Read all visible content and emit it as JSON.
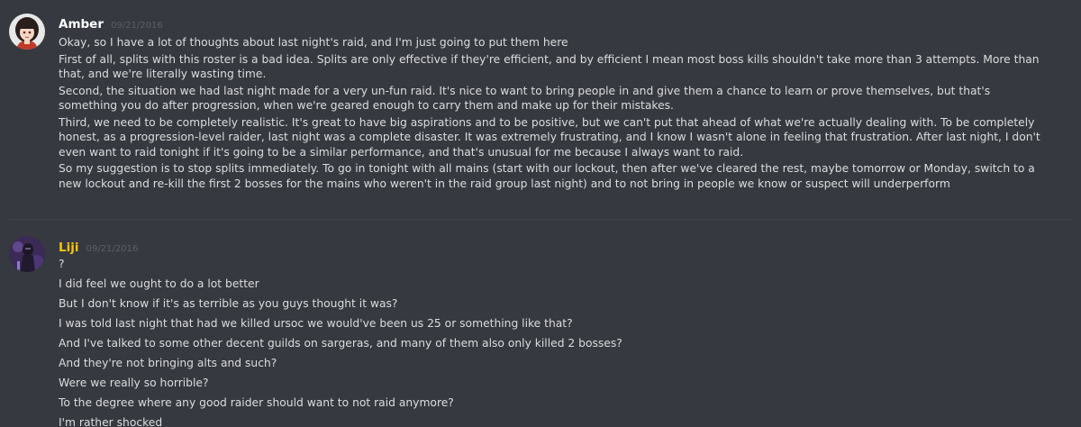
{
  "messages": [
    {
      "username": "Amber",
      "username_color": "#ffffff",
      "timestamp": "09/21/2016",
      "avatar_icon": "anime-girl-avatar",
      "lines": [
        "Okay, so I have a lot of thoughts about last night's raid, and I'm just going to put them here",
        "First of all, splits with this roster is a bad idea. Splits are only effective if they're efficient, and by efficient I mean most boss kills shouldn't take more than 3 attempts. More than that, and we're literally wasting time.",
        "Second, the situation we had last night made for a very un-fun raid. It's nice to want to bring people in and give them a chance to learn or prove themselves, but that's something you do after progression, when we're geared enough to carry them and make up for their mistakes.",
        "Third, we need to be completely realistic. It's great to have big aspirations and to be positive, but we can't put that ahead of what we're actually dealing with. To be completely honest, as a progression-level raider, last night was a complete disaster. It was extremely frustrating, and I know I wasn't alone in feeling that frustration. After last night, I don't even want to raid tonight if it's going to be a similar performance, and that's unusual for me because I always want to raid.",
        "So my suggestion is to stop splits immediately. To go in tonight with all mains (start with our lockout, then after we've cleared the rest, maybe tomorrow or Monday, switch to a new lockout and re-kill the first 2 bosses for the mains who weren't in the raid group last night) and to not bring in people we know or suspect will underperform"
      ]
    },
    {
      "username": "Liji",
      "username_color": "#f1c40f",
      "timestamp": "09/21/2016",
      "avatar_icon": "dark-character-avatar",
      "lines": [
        "?",
        "I did feel we ought to do a lot better",
        "But I don't know if it's as terrible as you guys thought it was?",
        "I was told last night that had we killed ursoc we would've been us 25 or something like that?",
        "And I've talked to some other decent guilds on sargeras, and many of them also only killed 2 bosses?",
        "And they're not bringing alts and such?",
        "Were we really so horrible?",
        "To the degree where any good raider should want to not raid anymore?",
        "I'm rather shocked"
      ]
    }
  ]
}
